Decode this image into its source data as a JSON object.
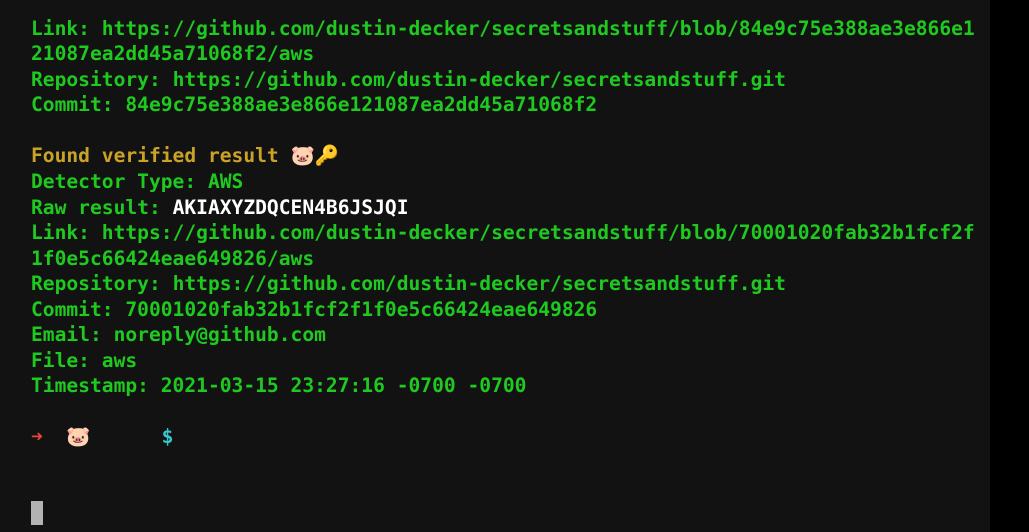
{
  "terminal": {
    "first_result": {
      "link_label": "Link: ",
      "link_line1": "https://github.com/dustin-decker/secretsandstuff/blob/84e9c75e388ae3e866e1",
      "link_line2": "21087ea2dd45a71068f2/aws",
      "repo_label": "Repository: ",
      "repo_value": "https://github.com/dustin-decker/secretsandstuff.git",
      "commit_label": "Commit: ",
      "commit_value": "84e9c75e388ae3e866e121087ea2dd45a71068f2"
    },
    "second_result": {
      "found_text": "Found verified result ",
      "found_emoji": "🐷🔑",
      "detector_label": "Detector Type: ",
      "detector_value": "AWS",
      "raw_label": "Raw result: ",
      "raw_value": "AKIAXYZDQCEN4B6JSJQI",
      "link_label": "Link: ",
      "link_line1": "https://github.com/dustin-decker/secretsandstuff/blob/70001020fab32b1fcf2f",
      "link_line2": "1f0e5c66424eae649826/aws",
      "repo_label": "Repository: ",
      "repo_value": "https://github.com/dustin-decker/secretsandstuff.git",
      "commit_label": "Commit: ",
      "commit_value": "70001020fab32b1fcf2f1f0e5c66424eae649826",
      "email_label": "Email: ",
      "email_value": "noreply@github.com",
      "file_label": "File: ",
      "file_value": "aws",
      "timestamp_label": "Timestamp: ",
      "timestamp_value": "2021-03-15 23:27:16 -0700 -0700"
    },
    "prompt": {
      "arrow": "➜",
      "emoji": "🐷",
      "dollar": "$"
    }
  },
  "colors": {
    "background": "#121212",
    "green": "#1fc91f",
    "found_yellow": "#c9a227",
    "raw_white": "#ffffff",
    "arrow_red": "#e8453c",
    "dollar_cyan": "#39c5cf",
    "cursor_gray": "#b3b3b3"
  }
}
